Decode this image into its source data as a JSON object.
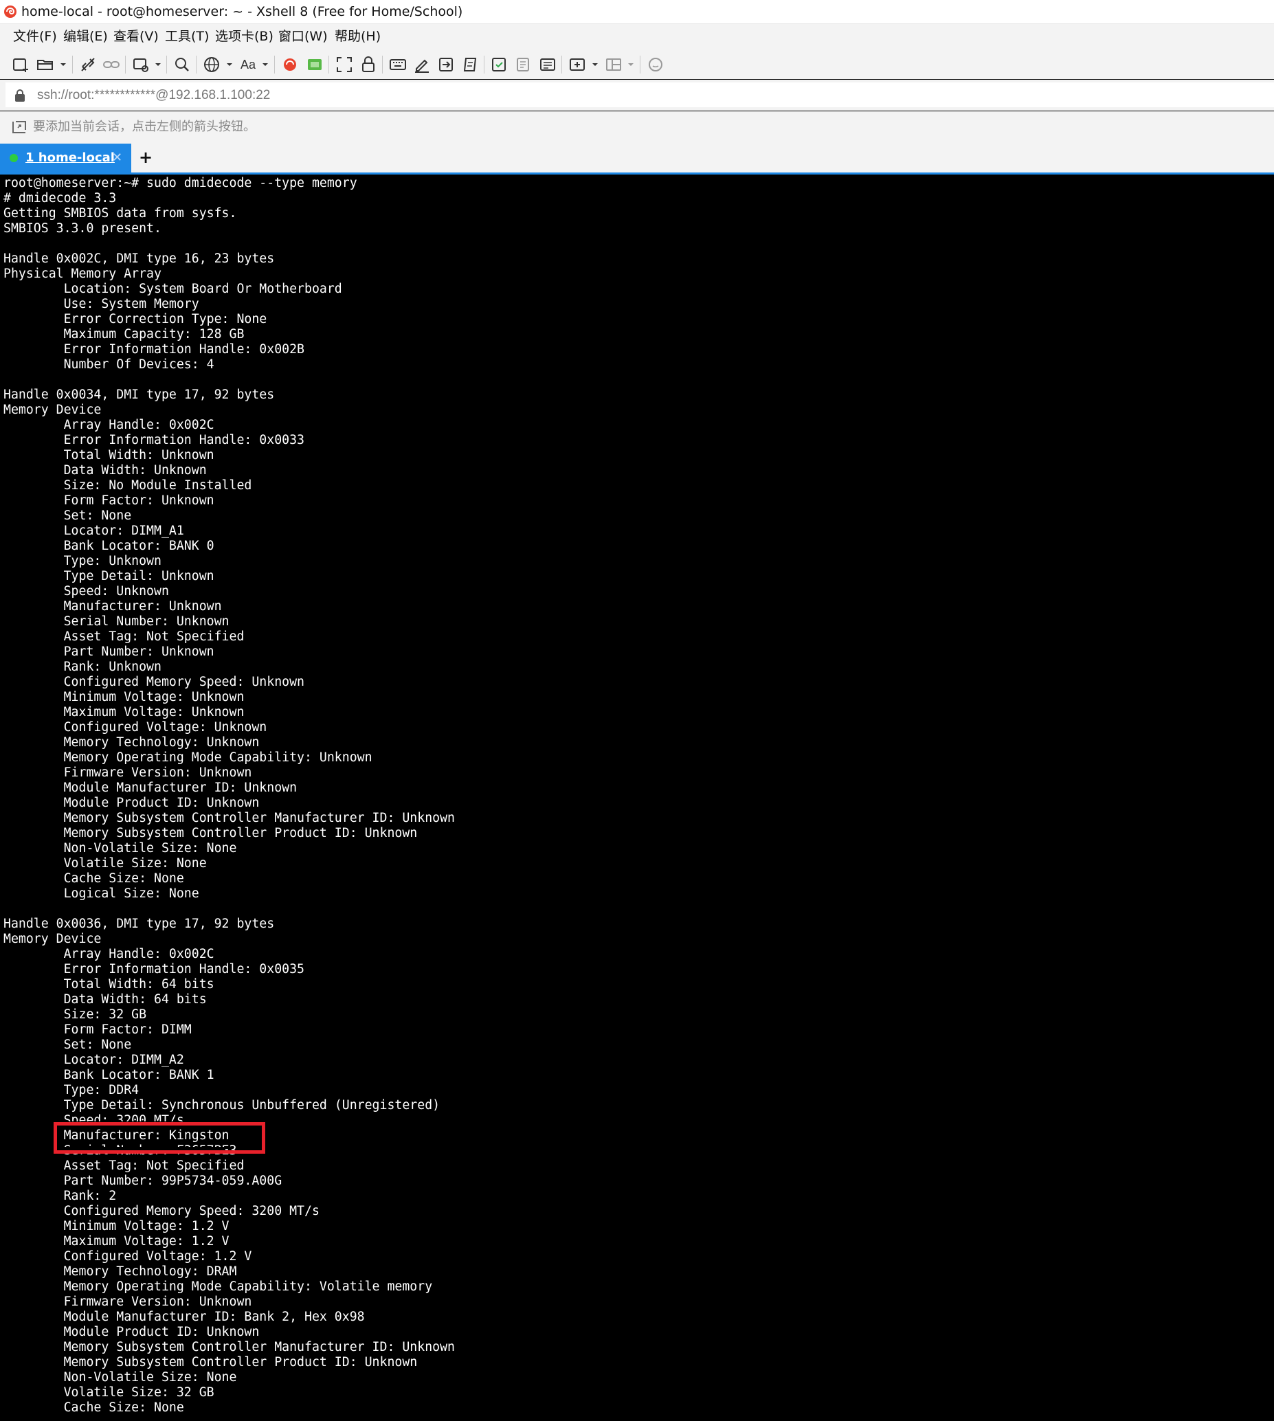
{
  "window": {
    "title": "home-local - root@homeserver: ~ - Xshell 8 (Free for Home/School)"
  },
  "menu": [
    "文件(F)",
    "编辑(E)",
    "查看(V)",
    "工具(T)",
    "选项卡(B)",
    "窗口(W)",
    "帮助(H)"
  ],
  "toolbar": {
    "icons": [
      "new-session-icon",
      "open-session-icon",
      "disconnect-icon",
      "reconnect-icon",
      "new-window-icon",
      "find-icon",
      "globe-icon",
      "font-icon",
      "xftp-icon",
      "xmanager-icon",
      "fullscreen-icon",
      "lock-icon",
      "keyboard-icon",
      "compose-icon",
      "transfer-icon",
      "script-icon",
      "log-icon",
      "print-icon",
      "notes-icon",
      "add-tab-icon",
      "layout-icon",
      "chat-icon"
    ],
    "font_label": "Aa"
  },
  "address": {
    "value": "ssh://root:************@192.168.1.100:22"
  },
  "session_hint": "要添加当前会话，点击左侧的箭头按钮。",
  "tabs": [
    {
      "label": "1 home-local",
      "status": "connected",
      "active": true
    }
  ],
  "tab_add_label": "+",
  "colors": {
    "accent": "#1e88e5",
    "terminal_bg": "#000000",
    "terminal_fg": "#ffffff",
    "highlight": "#e8212b",
    "status_dot": "#2ecc40"
  },
  "terminal": {
    "lines": [
      "root@homeserver:~# sudo dmidecode --type memory",
      "# dmidecode 3.3",
      "Getting SMBIOS data from sysfs.",
      "SMBIOS 3.3.0 present.",
      "",
      "Handle 0x002C, DMI type 16, 23 bytes",
      "Physical Memory Array",
      "        Location: System Board Or Motherboard",
      "        Use: System Memory",
      "        Error Correction Type: None",
      "        Maximum Capacity: 128 GB",
      "        Error Information Handle: 0x002B",
      "        Number Of Devices: 4",
      "",
      "Handle 0x0034, DMI type 17, 92 bytes",
      "Memory Device",
      "        Array Handle: 0x002C",
      "        Error Information Handle: 0x0033",
      "        Total Width: Unknown",
      "        Data Width: Unknown",
      "        Size: No Module Installed",
      "        Form Factor: Unknown",
      "        Set: None",
      "        Locator: DIMM_A1",
      "        Bank Locator: BANK 0",
      "        Type: Unknown",
      "        Type Detail: Unknown",
      "        Speed: Unknown",
      "        Manufacturer: Unknown",
      "        Serial Number: Unknown",
      "        Asset Tag: Not Specified",
      "        Part Number: Unknown",
      "        Rank: Unknown",
      "        Configured Memory Speed: Unknown",
      "        Minimum Voltage: Unknown",
      "        Maximum Voltage: Unknown",
      "        Configured Voltage: Unknown",
      "        Memory Technology: Unknown",
      "        Memory Operating Mode Capability: Unknown",
      "        Firmware Version: Unknown",
      "        Module Manufacturer ID: Unknown",
      "        Module Product ID: Unknown",
      "        Memory Subsystem Controller Manufacturer ID: Unknown",
      "        Memory Subsystem Controller Product ID: Unknown",
      "        Non-Volatile Size: None",
      "        Volatile Size: None",
      "        Cache Size: None",
      "        Logical Size: None",
      "",
      "Handle 0x0036, DMI type 17, 92 bytes",
      "Memory Device",
      "        Array Handle: 0x002C",
      "        Error Information Handle: 0x0035",
      "        Total Width: 64 bits",
      "        Data Width: 64 bits",
      "        Size: 32 GB",
      "        Form Factor: DIMM",
      "        Set: None",
      "        Locator: DIMM_A2",
      "        Bank Locator: BANK 1",
      "        Type: DDR4",
      "        Type Detail: Synchronous Unbuffered (Unregistered)",
      "        Speed: 3200 MT/s",
      "        Manufacturer: Kingston",
      "        Serial Number: F3657BE3",
      "        Asset Tag: Not Specified",
      "        Part Number: 99P5734-059.A00G",
      "        Rank: 2",
      "        Configured Memory Speed: 3200 MT/s",
      "        Minimum Voltage: 1.2 V",
      "        Maximum Voltage: 1.2 V",
      "        Configured Voltage: 1.2 V",
      "        Memory Technology: DRAM",
      "        Memory Operating Mode Capability: Volatile memory",
      "        Firmware Version: Unknown",
      "        Module Manufacturer ID: Bank 2, Hex 0x98",
      "        Module Product ID: Unknown",
      "        Memory Subsystem Controller Manufacturer ID: Unknown",
      "        Memory Subsystem Controller Product ID: Unknown",
      "        Non-Volatile Size: None",
      "        Volatile Size: 32 GB",
      "        Cache Size: None"
    ],
    "highlighted_line": "        Manufacturer: Kingston"
  }
}
